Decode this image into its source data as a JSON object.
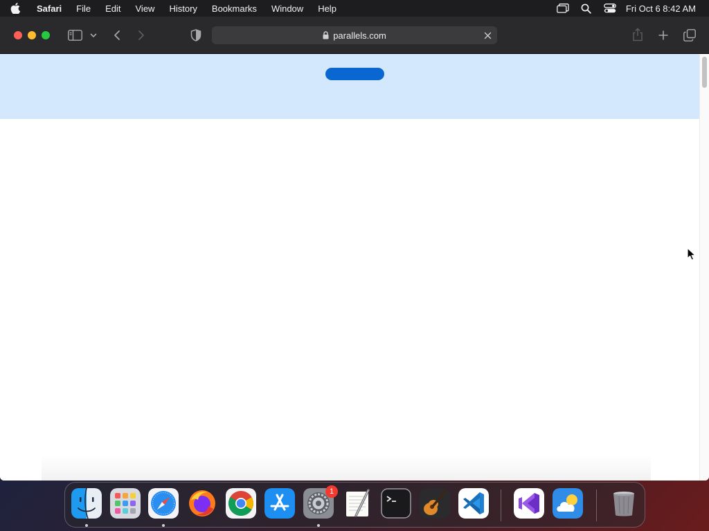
{
  "menubar": {
    "app_name": "Safari",
    "items": [
      "File",
      "Edit",
      "View",
      "History",
      "Bookmarks",
      "Window",
      "Help"
    ],
    "clock": "Fri Oct 6  8:42 AM",
    "status_icons": [
      "screen-mirroring-icon",
      "spotlight-search-icon",
      "control-center-icon"
    ]
  },
  "browser": {
    "address": "parallels.com",
    "toolbar_icons": [
      "sidebar-icon",
      "chevron-down-icon",
      "back-icon",
      "forward-icon",
      "privacy-shield-icon",
      "share-icon",
      "new-tab-icon",
      "tab-overview-icon"
    ]
  },
  "page": {
    "banner_color": "#d4e8fd",
    "pill_color": "#0a66d1"
  },
  "dock": {
    "apps": [
      {
        "name": "Finder",
        "running": true
      },
      {
        "name": "Launchpad",
        "running": false
      },
      {
        "name": "Safari",
        "running": true
      },
      {
        "name": "Firefox",
        "running": false
      },
      {
        "name": "Google Chrome",
        "running": false
      },
      {
        "name": "App Store",
        "running": false
      },
      {
        "name": "System Settings",
        "running": true,
        "badge": "1"
      },
      {
        "name": "TextEdit",
        "running": false
      },
      {
        "name": "Terminal",
        "running": false
      },
      {
        "name": "GarageBand",
        "running": false
      },
      {
        "name": "Visual Studio Code",
        "running": false
      },
      {
        "name": "Visual Studio",
        "running": false
      },
      {
        "name": "Weather",
        "running": false
      },
      {
        "name": "Trash",
        "running": false
      }
    ]
  }
}
